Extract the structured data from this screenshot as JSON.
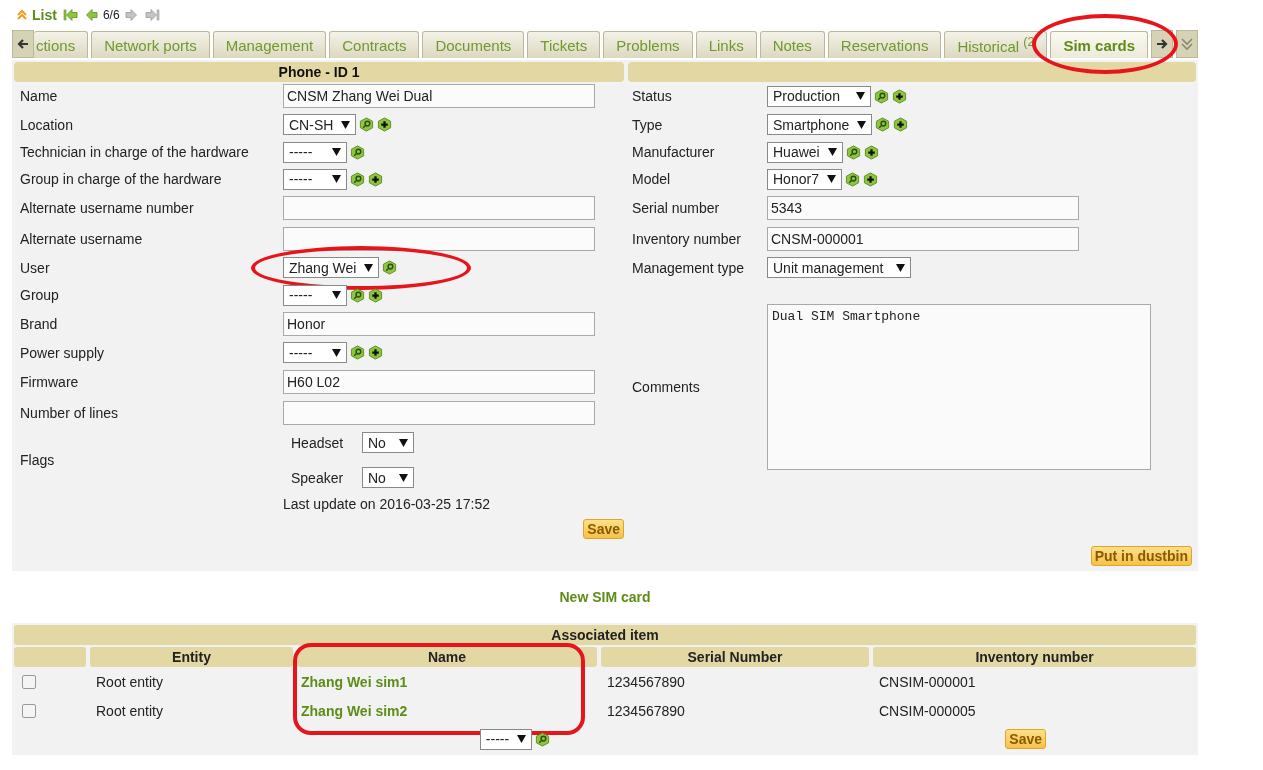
{
  "nav": {
    "label": "List",
    "counter": "6/6",
    "first_disabled": false,
    "prev_disabled": false,
    "next_disabled": true,
    "last_disabled": true
  },
  "tabs": [
    {
      "label": "ctions",
      "selected": false,
      "circled": false
    },
    {
      "label": "Network ports",
      "selected": false,
      "circled": false
    },
    {
      "label": "Management",
      "selected": false,
      "circled": false
    },
    {
      "label": "Contracts",
      "selected": false,
      "circled": false
    },
    {
      "label": "Documents",
      "selected": false,
      "circled": false
    },
    {
      "label": "Tickets",
      "selected": false,
      "circled": false
    },
    {
      "label": "Problems",
      "selected": false,
      "circled": false
    },
    {
      "label": "Links",
      "selected": false,
      "circled": false
    },
    {
      "label": "Notes",
      "selected": false,
      "circled": false
    },
    {
      "label": "Reservations",
      "selected": false,
      "circled": false
    },
    {
      "label": "Historical $^{(2}$",
      "selected": false,
      "circled": false
    },
    {
      "label": "Sim cards",
      "selected": true,
      "circled": true
    }
  ],
  "form": {
    "title": "Phone - ID 1",
    "left_fields": [
      {
        "kind": "text",
        "label": "Name",
        "value": "CNSM Zhang Wei Dual"
      },
      {
        "kind": "select",
        "label": "Location",
        "value": "CN-SH",
        "lookup": true,
        "add": true
      },
      {
        "kind": "select",
        "label": "Technician in charge of the hardware",
        "value": "-----",
        "lookup": true,
        "add": false
      },
      {
        "kind": "select",
        "label": "Group in charge of the hardware",
        "value": "-----",
        "lookup": true,
        "add": true
      },
      {
        "kind": "text",
        "label": "Alternate username number"
      },
      {
        "kind": "text",
        "label": "Alternate username"
      },
      {
        "kind": "select",
        "label": "User",
        "value": "Zhang Wei",
        "lookup": true,
        "add": false,
        "circled": true
      },
      {
        "kind": "select",
        "label": "Group",
        "value": "-----",
        "lookup": true,
        "add": true
      },
      {
        "kind": "text",
        "label": "Brand",
        "value": "Honor"
      },
      {
        "kind": "select",
        "label": "Power supply",
        "value": "-----",
        "lookup": true,
        "add": true
      },
      {
        "kind": "text",
        "label": "Firmware",
        "value": "H60 L02"
      },
      {
        "kind": "text",
        "label": "Number of lines"
      },
      {
        "kind": "flags",
        "label": "Flags",
        "items": [
          {
            "label": "Headset",
            "value": "No"
          },
          {
            "label": "Speaker",
            "value": "No"
          }
        ]
      }
    ],
    "right_fields": [
      {
        "kind": "select",
        "label": "Status",
        "value": "Production",
        "lookup": true,
        "add": true
      },
      {
        "kind": "select",
        "label": "Type",
        "value": "Smartphone",
        "lookup": true,
        "add": true
      },
      {
        "kind": "select",
        "label": "Manufacturer",
        "value": "Huawei",
        "lookup": true,
        "add": true
      },
      {
        "kind": "select",
        "label": "Model",
        "value": "Honor7",
        "lookup": true,
        "add": true
      },
      {
        "kind": "text",
        "label": "Serial number",
        "value": "5343"
      },
      {
        "kind": "text",
        "label": "Inventory number",
        "value": "CNSM-000001"
      },
      {
        "kind": "select",
        "label": "Management type",
        "value": "Unit management"
      },
      {
        "kind": "textarea",
        "label": "Comments",
        "value": "Dual SIM Smartphone"
      }
    ],
    "last_update": "Last update on 2016-03-25 17:52",
    "save": "Save",
    "dustbin": "Put in dustbin"
  },
  "new_link": "New SIM card",
  "table": {
    "title": "Associated item",
    "columns": [
      {
        "label": "Entity",
        "circled": false
      },
      {
        "label": "Name",
        "circled": true
      },
      {
        "label": "Serial Number",
        "circled": false
      },
      {
        "label": "Inventory number",
        "circled": false
      }
    ],
    "rows": [
      {
        "checked": false,
        "entity": "Root entity",
        "name": "Zhang Wei sim1",
        "serial": "1234567890",
        "inventory": "CNSIM-000001"
      },
      {
        "checked": false,
        "entity": "Root entity",
        "name": "Zhang Wei sim2",
        "serial": "1234567890",
        "inventory": "CNSIM-000005"
      }
    ],
    "action_select": "-----",
    "save": "Save"
  }
}
